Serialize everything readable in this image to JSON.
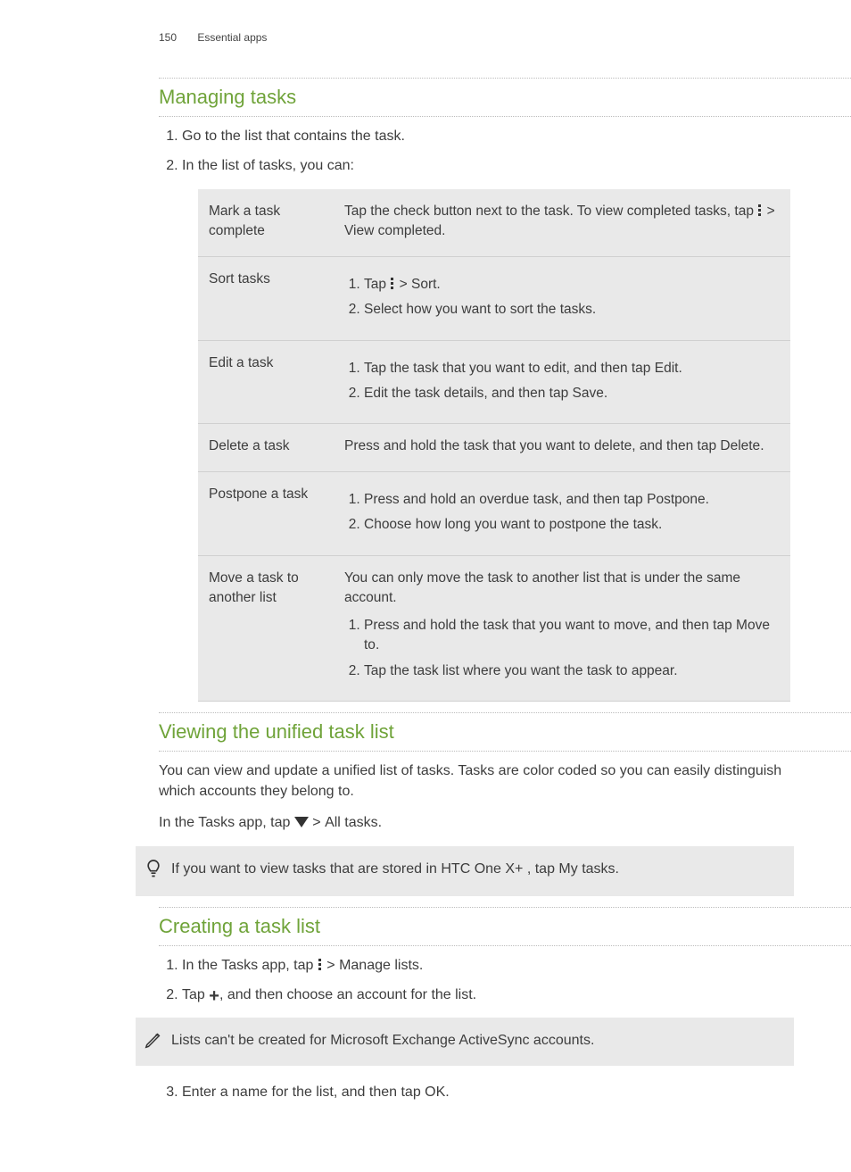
{
  "header": {
    "page_number": "150",
    "section": "Essential apps"
  },
  "managing": {
    "heading": "Managing tasks",
    "step1": "Go to the list that contains the task.",
    "step2": "In the list of tasks, you can:",
    "rows": {
      "mark": {
        "label": "Mark a task complete",
        "body_a": "Tap the check button next to the task. To view completed tasks, tap ",
        "body_b": " > ",
        "body_c": "View completed",
        "body_d": "."
      },
      "sort": {
        "label": "Sort tasks",
        "s1a": "Tap ",
        "s1b": " > ",
        "s1c": "Sort",
        "s1d": ".",
        "s2": "Select how you want to sort the tasks."
      },
      "edit": {
        "label": "Edit a task",
        "s1a": "Tap the task that you want to edit, and then tap ",
        "s1b": "Edit",
        "s1c": ".",
        "s2a": "Edit the task details, and then tap ",
        "s2b": "Save",
        "s2c": "."
      },
      "delete": {
        "label": "Delete a task",
        "body_a": "Press and hold the task that you want to delete, and then tap ",
        "body_b": "Delete",
        "body_c": "."
      },
      "postpone": {
        "label": "Postpone a task",
        "s1a": "Press and hold an overdue task, and then tap ",
        "s1b": "Postpone",
        "s1c": ".",
        "s2": "Choose how long you want to postpone the task."
      },
      "move": {
        "label": "Move a task to another list",
        "pre": "You can only move the task to another list that is under the same account.",
        "s1a": "Press and hold the task that you want to move, and then tap ",
        "s1b": "Move to",
        "s1c": ".",
        "s2": "Tap the task list where you want the task to appear."
      }
    }
  },
  "viewing": {
    "heading": "Viewing the unified task list",
    "p1": "You can view and update a unified list of tasks. Tasks are color coded so you can easily distinguish which accounts they belong to.",
    "p2a": "In the Tasks app, tap ",
    "p2b": " > ",
    "p2c": "All tasks",
    "p2d": ".",
    "tip_a": "If you want to view tasks that are stored in HTC One X+ , tap ",
    "tip_b": "My tasks",
    "tip_c": "."
  },
  "creating": {
    "heading": "Creating a task list",
    "s1a": "In the Tasks app, tap ",
    "s1b": " > ",
    "s1c": "Manage lists",
    "s1d": ".",
    "s2a": "Tap ",
    "s2b": ", and then choose an account for the list.",
    "note": "Lists can't be created for Microsoft Exchange ActiveSync accounts.",
    "s3a": "Enter a name for the list, and then tap ",
    "s3b": "OK",
    "s3c": "."
  }
}
